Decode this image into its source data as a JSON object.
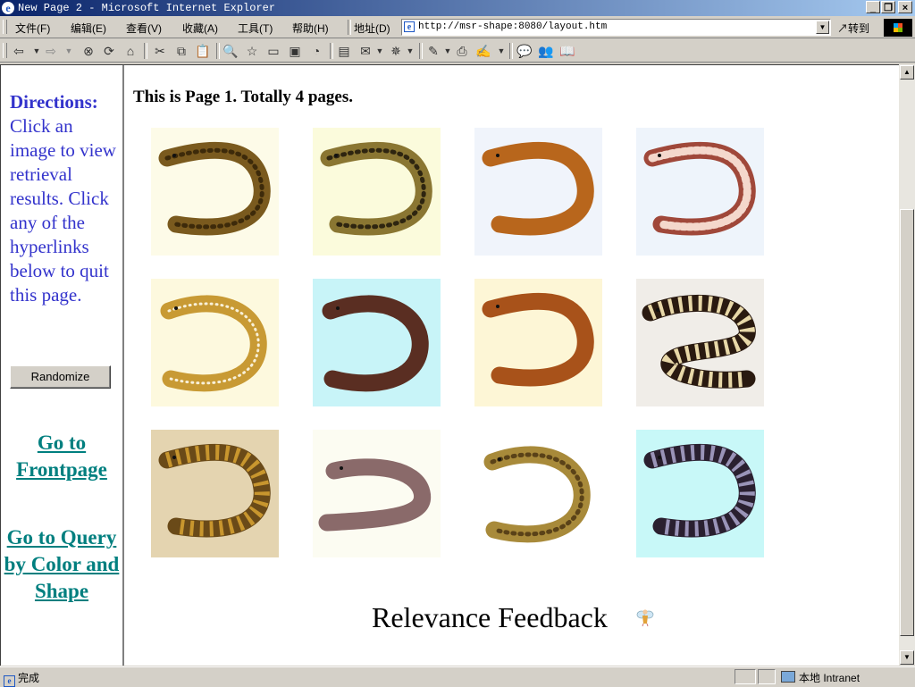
{
  "window": {
    "title": "New Page 2 - Microsoft Internet Explorer",
    "minimize_label": "_",
    "restore_label": "❐",
    "close_label": "×"
  },
  "menu": {
    "items": [
      "文件(F)",
      "编辑(E)",
      "查看(V)",
      "收藏(A)",
      "工具(T)",
      "帮助(H)"
    ],
    "address_label": "地址(D)",
    "address_value": "http://msr-shape:8080/layout.htm",
    "go_label": "↗转到"
  },
  "toolbar": {
    "icons": [
      "back-icon",
      "forward-icon",
      "stop-icon",
      "refresh-icon",
      "home-icon",
      "cut-icon",
      "copy-icon",
      "paste-icon",
      "search-icon",
      "favorites-icon",
      "history-icon",
      "mail-icon",
      "print-icon",
      "edit-icon",
      "discuss-icon",
      "messenger-icon"
    ]
  },
  "left_panel": {
    "directions_heading": "Directions:",
    "directions_text": "Click an image to view retrieval results. Click any of the hyperlinks below to quit this page.",
    "randomize_label": "Randomize",
    "link_frontpage": "Go to Frontpage",
    "link_query": "Go to Query by Color and Shape"
  },
  "main": {
    "page_info": "This is Page 1. Totally 4 pages.",
    "feedback_label": "Relevance Feedback",
    "images": [
      {
        "bg": "#fdfbe8",
        "body": "#7a5a1e",
        "spot": "#3d2a0a",
        "pattern": "spots",
        "curve": "u"
      },
      {
        "bg": "#fbfbdc",
        "body": "#8a7632",
        "spot": "#2e2510",
        "pattern": "spots",
        "curve": "u"
      },
      {
        "bg": "#f0f4fb",
        "body": "#b8661c",
        "spot": "#8a4410",
        "pattern": "none",
        "curve": "u"
      },
      {
        "bg": "#eef4fb",
        "body": "#a0483a",
        "spot": "#f4d8cc",
        "pattern": "mesh",
        "curve": "u"
      },
      {
        "bg": "#fdf9de",
        "body": "#c89a34",
        "spot": "#f8f0d8",
        "pattern": "dots",
        "curve": "c"
      },
      {
        "bg": "#c8f4f8",
        "body": "#5a2e22",
        "spot": "#3a1c14",
        "pattern": "none",
        "curve": "c"
      },
      {
        "bg": "#fdf6d6",
        "body": "#a8521a",
        "spot": "#6a3010",
        "pattern": "none",
        "curve": "u"
      },
      {
        "bg": "#f0ede8",
        "body": "#2a1a10",
        "spot": "#e8d8a8",
        "pattern": "bands",
        "curve": "s"
      },
      {
        "bg": "#e4d4b0",
        "body": "#6a4a18",
        "spot": "#c8962e",
        "pattern": "bands",
        "curve": "u"
      },
      {
        "bg": "#fcfcf2",
        "body": "#8a6a6a",
        "spot": "#5a4242",
        "pattern": "none",
        "curve": "w"
      },
      {
        "bg": "#ffffff",
        "body": "#a88a3a",
        "spot": "#5a4218",
        "pattern": "spots",
        "curve": "c"
      },
      {
        "bg": "#c8f8f8",
        "body": "#2a2030",
        "spot": "#9a94b8",
        "pattern": "bands",
        "curve": "u"
      }
    ]
  },
  "statusbar": {
    "status_text": "完成",
    "zone_label": "本地 Intranet"
  }
}
